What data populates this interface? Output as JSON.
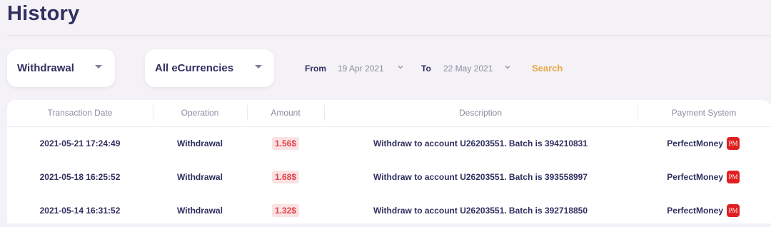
{
  "page": {
    "title": "History"
  },
  "filters": {
    "operation": "Withdrawal",
    "currency": "All eCurrencies",
    "from_label": "From",
    "from_date": "19 Apr 2021",
    "to_label": "To",
    "to_date": "22 May 2021",
    "search_label": "Search"
  },
  "table": {
    "headers": [
      "Transaction Date",
      "Operation",
      "Amount",
      "Description",
      "Payment System"
    ],
    "rows": [
      {
        "date": "2021-05-21 17:24:49",
        "operation": "Withdrawal",
        "amount": "1.56$",
        "description": "Withdraw to account U26203551. Batch is 394210831",
        "system": "PerfectMoney"
      },
      {
        "date": "2021-05-18 16:25:52",
        "operation": "Withdrawal",
        "amount": "1.68$",
        "description": "Withdraw to account U26203551. Batch is 393558997",
        "system": "PerfectMoney"
      },
      {
        "date": "2021-05-14 16:31:52",
        "operation": "Withdrawal",
        "amount": "1.32$",
        "description": "Withdraw to account U26203551. Batch is 392718850",
        "system": "PerfectMoney"
      }
    ],
    "system_icon_text": "PM"
  },
  "colors": {
    "accent": "#e8a94a",
    "negative": "#e0414a",
    "pm_brand": "#e02020"
  }
}
